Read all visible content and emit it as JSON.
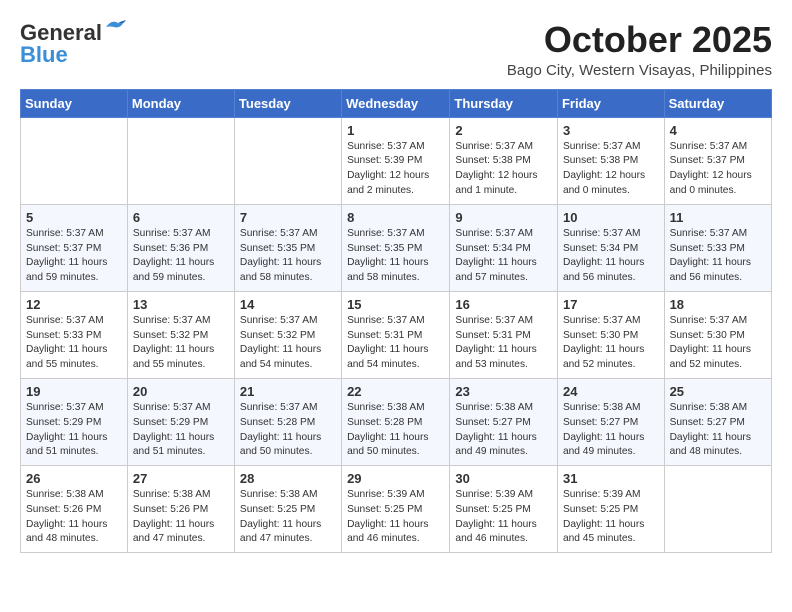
{
  "header": {
    "logo_general": "General",
    "logo_blue": "Blue",
    "month": "October 2025",
    "location": "Bago City, Western Visayas, Philippines"
  },
  "weekdays": [
    "Sunday",
    "Monday",
    "Tuesday",
    "Wednesday",
    "Thursday",
    "Friday",
    "Saturday"
  ],
  "weeks": [
    [
      {
        "day": "",
        "info": ""
      },
      {
        "day": "",
        "info": ""
      },
      {
        "day": "",
        "info": ""
      },
      {
        "day": "1",
        "info": "Sunrise: 5:37 AM\nSunset: 5:39 PM\nDaylight: 12 hours\nand 2 minutes."
      },
      {
        "day": "2",
        "info": "Sunrise: 5:37 AM\nSunset: 5:38 PM\nDaylight: 12 hours\nand 1 minute."
      },
      {
        "day": "3",
        "info": "Sunrise: 5:37 AM\nSunset: 5:38 PM\nDaylight: 12 hours\nand 0 minutes."
      },
      {
        "day": "4",
        "info": "Sunrise: 5:37 AM\nSunset: 5:37 PM\nDaylight: 12 hours\nand 0 minutes."
      }
    ],
    [
      {
        "day": "5",
        "info": "Sunrise: 5:37 AM\nSunset: 5:37 PM\nDaylight: 11 hours\nand 59 minutes."
      },
      {
        "day": "6",
        "info": "Sunrise: 5:37 AM\nSunset: 5:36 PM\nDaylight: 11 hours\nand 59 minutes."
      },
      {
        "day": "7",
        "info": "Sunrise: 5:37 AM\nSunset: 5:35 PM\nDaylight: 11 hours\nand 58 minutes."
      },
      {
        "day": "8",
        "info": "Sunrise: 5:37 AM\nSunset: 5:35 PM\nDaylight: 11 hours\nand 58 minutes."
      },
      {
        "day": "9",
        "info": "Sunrise: 5:37 AM\nSunset: 5:34 PM\nDaylight: 11 hours\nand 57 minutes."
      },
      {
        "day": "10",
        "info": "Sunrise: 5:37 AM\nSunset: 5:34 PM\nDaylight: 11 hours\nand 56 minutes."
      },
      {
        "day": "11",
        "info": "Sunrise: 5:37 AM\nSunset: 5:33 PM\nDaylight: 11 hours\nand 56 minutes."
      }
    ],
    [
      {
        "day": "12",
        "info": "Sunrise: 5:37 AM\nSunset: 5:33 PM\nDaylight: 11 hours\nand 55 minutes."
      },
      {
        "day": "13",
        "info": "Sunrise: 5:37 AM\nSunset: 5:32 PM\nDaylight: 11 hours\nand 55 minutes."
      },
      {
        "day": "14",
        "info": "Sunrise: 5:37 AM\nSunset: 5:32 PM\nDaylight: 11 hours\nand 54 minutes."
      },
      {
        "day": "15",
        "info": "Sunrise: 5:37 AM\nSunset: 5:31 PM\nDaylight: 11 hours\nand 54 minutes."
      },
      {
        "day": "16",
        "info": "Sunrise: 5:37 AM\nSunset: 5:31 PM\nDaylight: 11 hours\nand 53 minutes."
      },
      {
        "day": "17",
        "info": "Sunrise: 5:37 AM\nSunset: 5:30 PM\nDaylight: 11 hours\nand 52 minutes."
      },
      {
        "day": "18",
        "info": "Sunrise: 5:37 AM\nSunset: 5:30 PM\nDaylight: 11 hours\nand 52 minutes."
      }
    ],
    [
      {
        "day": "19",
        "info": "Sunrise: 5:37 AM\nSunset: 5:29 PM\nDaylight: 11 hours\nand 51 minutes."
      },
      {
        "day": "20",
        "info": "Sunrise: 5:37 AM\nSunset: 5:29 PM\nDaylight: 11 hours\nand 51 minutes."
      },
      {
        "day": "21",
        "info": "Sunrise: 5:37 AM\nSunset: 5:28 PM\nDaylight: 11 hours\nand 50 minutes."
      },
      {
        "day": "22",
        "info": "Sunrise: 5:38 AM\nSunset: 5:28 PM\nDaylight: 11 hours\nand 50 minutes."
      },
      {
        "day": "23",
        "info": "Sunrise: 5:38 AM\nSunset: 5:27 PM\nDaylight: 11 hours\nand 49 minutes."
      },
      {
        "day": "24",
        "info": "Sunrise: 5:38 AM\nSunset: 5:27 PM\nDaylight: 11 hours\nand 49 minutes."
      },
      {
        "day": "25",
        "info": "Sunrise: 5:38 AM\nSunset: 5:27 PM\nDaylight: 11 hours\nand 48 minutes."
      }
    ],
    [
      {
        "day": "26",
        "info": "Sunrise: 5:38 AM\nSunset: 5:26 PM\nDaylight: 11 hours\nand 48 minutes."
      },
      {
        "day": "27",
        "info": "Sunrise: 5:38 AM\nSunset: 5:26 PM\nDaylight: 11 hours\nand 47 minutes."
      },
      {
        "day": "28",
        "info": "Sunrise: 5:38 AM\nSunset: 5:25 PM\nDaylight: 11 hours\nand 47 minutes."
      },
      {
        "day": "29",
        "info": "Sunrise: 5:39 AM\nSunset: 5:25 PM\nDaylight: 11 hours\nand 46 minutes."
      },
      {
        "day": "30",
        "info": "Sunrise: 5:39 AM\nSunset: 5:25 PM\nDaylight: 11 hours\nand 46 minutes."
      },
      {
        "day": "31",
        "info": "Sunrise: 5:39 AM\nSunset: 5:25 PM\nDaylight: 11 hours\nand 45 minutes."
      },
      {
        "day": "",
        "info": ""
      }
    ]
  ]
}
